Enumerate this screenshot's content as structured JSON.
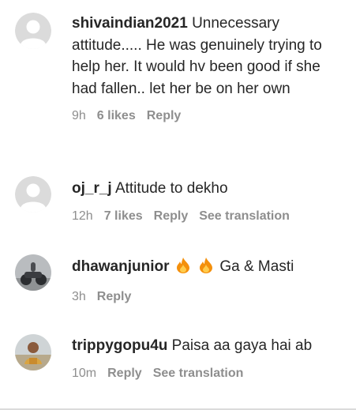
{
  "comments": [
    {
      "username": "shivaindian2021",
      "text": "Unnecessary attitude..... He was genuinely trying to help her. It would hv been good if she had fallen.. let her be on her own",
      "time": "9h",
      "likes": "6 likes",
      "reply": "Reply",
      "translation": ""
    },
    {
      "username": "oj_r_j",
      "text": "Attitude to dekho",
      "time": "12h",
      "likes": "7 likes",
      "reply": "Reply",
      "translation": "See translation"
    },
    {
      "username": "dhawanjunior",
      "text": "Ga & Masti",
      "time": "3h",
      "likes": "",
      "reply": "Reply",
      "translation": ""
    },
    {
      "username": "trippygopu4u",
      "text": "Paisa aa gaya hai ab",
      "time": "10m",
      "likes": "",
      "reply": "Reply",
      "translation": "See translation"
    }
  ],
  "colors": {
    "text": "#262626",
    "meta": "#8e8e8e",
    "avatar_placeholder": "#dbdbdb",
    "fire_outer": "#f4900c",
    "fire_inner": "#ffcc4d"
  },
  "icons": [
    "default-avatar-icon",
    "fire-emoji-icon"
  ]
}
